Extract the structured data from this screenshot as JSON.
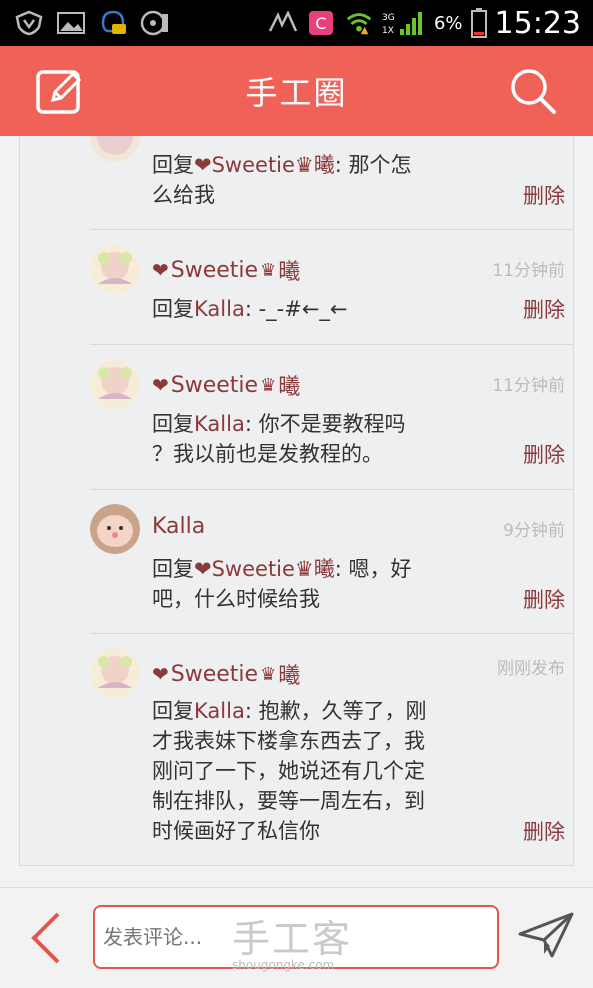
{
  "status_bar": {
    "battery_percent": "6%",
    "time": "15:23",
    "network_label_top": "3G",
    "network_label_bottom": "1X"
  },
  "header": {
    "title": "手工圈"
  },
  "comments": [
    {
      "author": "",
      "time": "",
      "reply_prefix": "回复",
      "reply_target": "❤Sweetie♛曦",
      "text_line1": ": 那个怎",
      "text_line2": "么给我",
      "delete_label": "删除"
    },
    {
      "author": "Sweetie",
      "author_suffix": "曦",
      "time": "11分钟前",
      "reply_prefix": "回复",
      "reply_target": "Kalla",
      "text_line1": ": -_-#←_←",
      "delete_label": "删除"
    },
    {
      "author": "Sweetie",
      "author_suffix": "曦",
      "time": "11分钟前",
      "reply_prefix": "回复",
      "reply_target": "Kalla",
      "text_line1": ": 你不是要教程吗",
      "text_line2": "？我以前也是发教程的。",
      "delete_label": "删除"
    },
    {
      "author": "Kalla",
      "time": "9分钟前",
      "reply_prefix": "回复",
      "reply_target": "❤Sweetie♛曦",
      "text_line1": ": 嗯，好",
      "text_line2": "吧，什么时候给我",
      "delete_label": "删除"
    },
    {
      "author": "Sweetie",
      "author_suffix": "曦",
      "time": "刚刚发布",
      "reply_prefix": "回复",
      "reply_target": "Kalla",
      "text_line1": ": 抱歉，久等了，刚",
      "text_line2": "才我表妹下楼拿东西去了，我",
      "text_line3": "刚问了一下，她说还有几个定",
      "text_line4": "制在排队，要等一周左右，到",
      "text_line5": "时候画好了私信你",
      "delete_label": "删除"
    }
  ],
  "bottom_bar": {
    "input_placeholder": "发表评论...",
    "watermark": "手工客",
    "watermark_url": "shougongke.com"
  },
  "colors": {
    "header_bg": "#f06158",
    "accent_text": "#8b3a3a",
    "input_border": "#e0574f"
  }
}
